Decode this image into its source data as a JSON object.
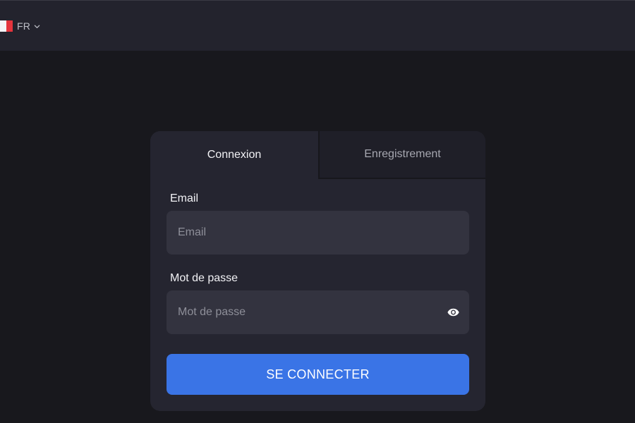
{
  "header": {
    "language": {
      "code": "FR",
      "flag": "french-flag-icon",
      "dropdown_icon": "chevron-down-icon"
    }
  },
  "auth": {
    "tabs": [
      {
        "label": "Connexion",
        "active": true
      },
      {
        "label": "Enregistrement",
        "active": false
      }
    ],
    "email": {
      "label": "Email",
      "placeholder": "Email",
      "value": ""
    },
    "password": {
      "label": "Mot de passe",
      "placeholder": "Mot de passe",
      "value": "",
      "toggle_icon": "eye-icon"
    },
    "submit_label": "SE CONNECTER"
  },
  "colors": {
    "background": "#18181d",
    "topbar": "#23232d",
    "card": "#252530",
    "input": "#33333f",
    "primary": "#3a74e6"
  }
}
